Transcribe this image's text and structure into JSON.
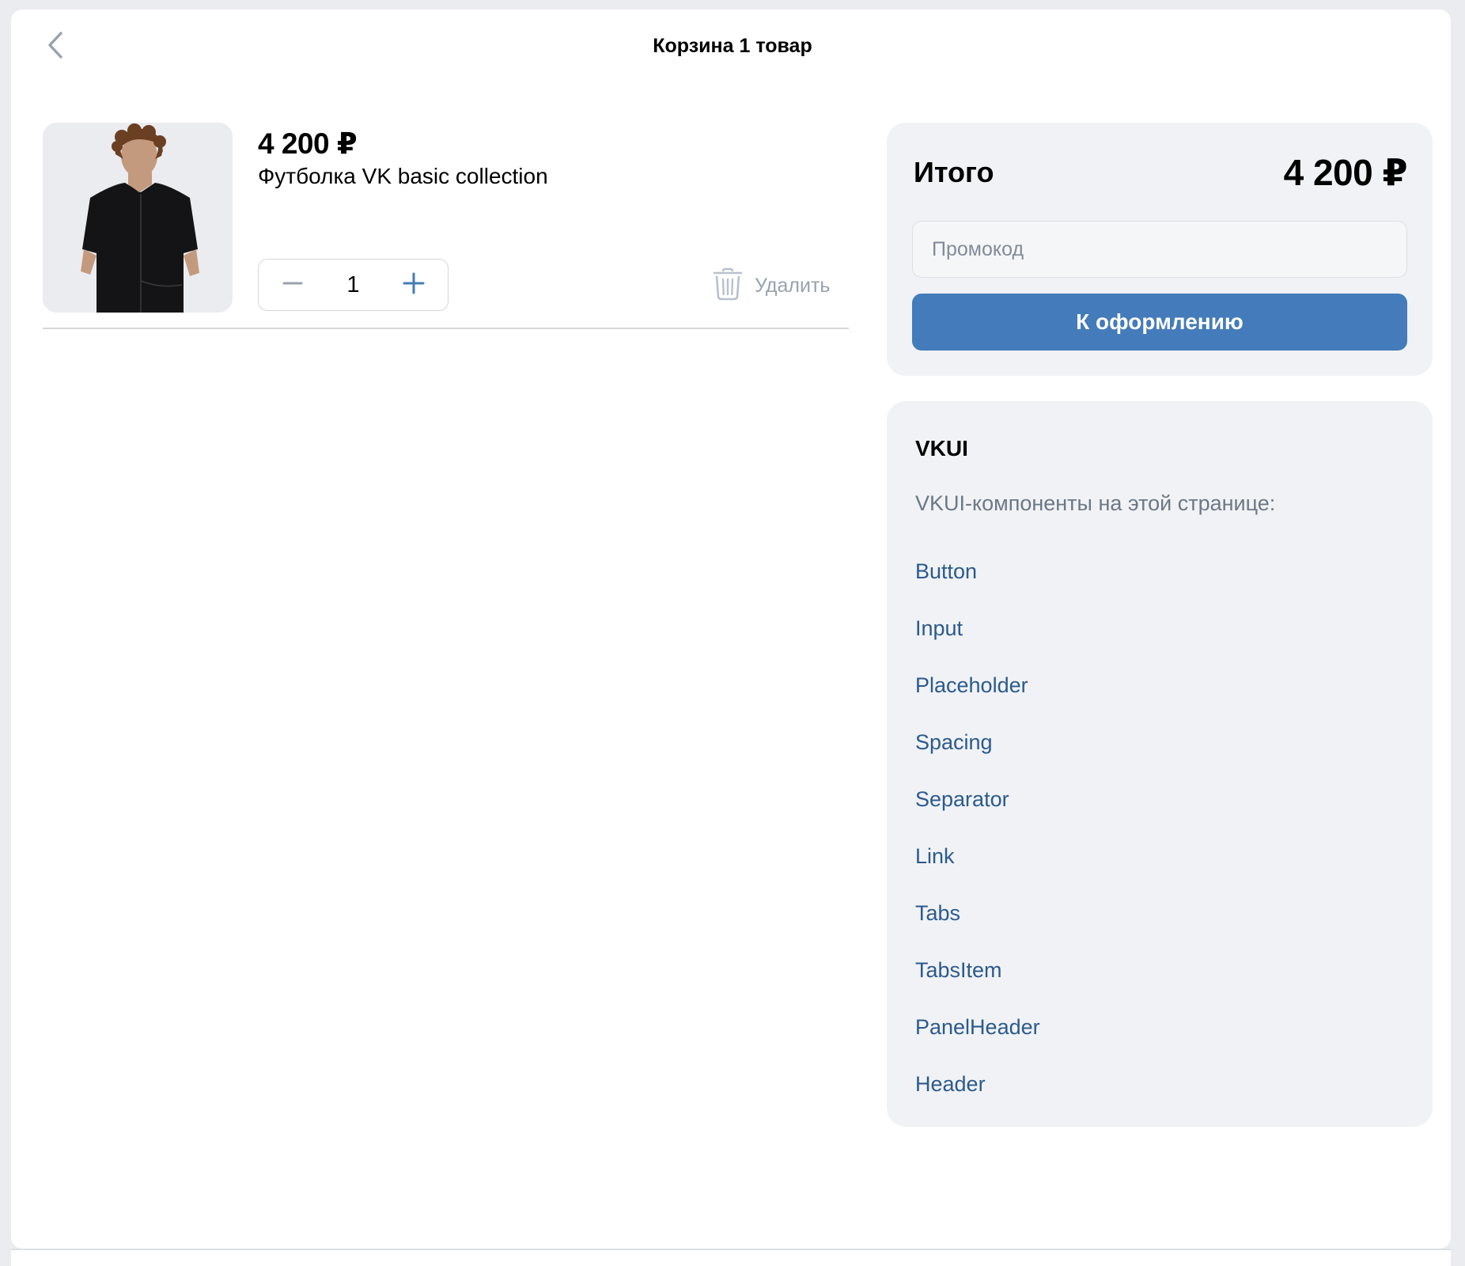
{
  "header": {
    "title": "Корзина 1 товар"
  },
  "product": {
    "price": "4 200 ₽",
    "name": "Футболка VK basic collection",
    "quantity": "1",
    "delete_label": "Удалить"
  },
  "summary": {
    "total_label": "Итого",
    "total_value": "4 200 ₽",
    "promo_placeholder": "Промокод",
    "checkout_label": "К оформлению"
  },
  "vkui": {
    "title": "VKUI",
    "subtitle": "VKUI-компоненты на этой странице:",
    "links": [
      "Button",
      "Input",
      "Placeholder",
      "Spacing",
      "Separator",
      "Link",
      "Tabs",
      "TabsItem",
      "PanelHeader",
      "Header"
    ]
  },
  "icons": {
    "back": "chevron-left-icon",
    "minus": "minus-icon",
    "plus": "plus-icon",
    "delete": "trash-icon"
  },
  "colors": {
    "accent": "#447bba",
    "link": "#2c5a8c",
    "card_background": "#f0f2f5",
    "secondary_text": "#99a2ad"
  }
}
